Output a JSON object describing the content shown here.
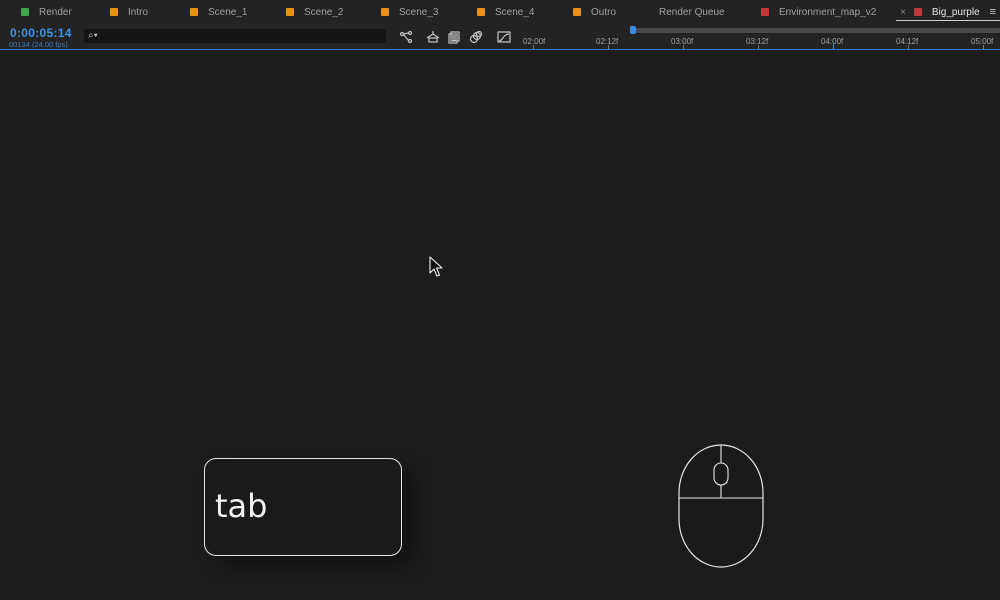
{
  "tabs": [
    {
      "label": "Render",
      "color": "#3ea84a"
    },
    {
      "label": "Intro",
      "color": "#e8901c"
    },
    {
      "label": "Scene_1",
      "color": "#e8901c"
    },
    {
      "label": "Scene_2",
      "color": "#e8901c"
    },
    {
      "label": "Scene_3",
      "color": "#e8901c"
    },
    {
      "label": "Scene_4",
      "color": "#e8901c"
    },
    {
      "label": "Outro",
      "color": "#e8901c"
    },
    {
      "label": "Render Queue",
      "color": ""
    },
    {
      "label": "Environment_map_v2",
      "color": "#c0393b"
    },
    {
      "label": "Big_purple",
      "color": "#c0393b",
      "active": true
    }
  ],
  "header": {
    "timecode": "0:00:05:14",
    "frames": "00134 (24.00 fps)",
    "search_placeholder": "",
    "search_glyph": "⌕▾"
  },
  "ruler": {
    "labels": [
      "02:00f",
      "02:12f",
      "03:00f",
      "03:12f",
      "04:00f",
      "04:12f",
      "05:00f"
    ]
  },
  "overlay": {
    "key_label": "tab"
  },
  "icons": {
    "tools": [
      "composition-flowchart-icon",
      "draft-3d-icon",
      "frame-blending-icon",
      "motion-blur-icon",
      "graph-editor-icon"
    ],
    "cursor": "cursor-icon",
    "mouse": "mouse-icon"
  },
  "colors": {
    "accent": "#3f93e8",
    "background": "#1c1c1c",
    "panel": "#232323"
  }
}
